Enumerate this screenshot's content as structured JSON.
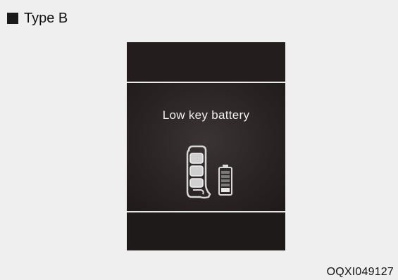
{
  "header": {
    "type_label": "Type B"
  },
  "display": {
    "message": "Low key battery",
    "icons": [
      "smart-key-icon",
      "battery-low-icon"
    ]
  },
  "footer": {
    "figure_code": "OQXI049127"
  }
}
